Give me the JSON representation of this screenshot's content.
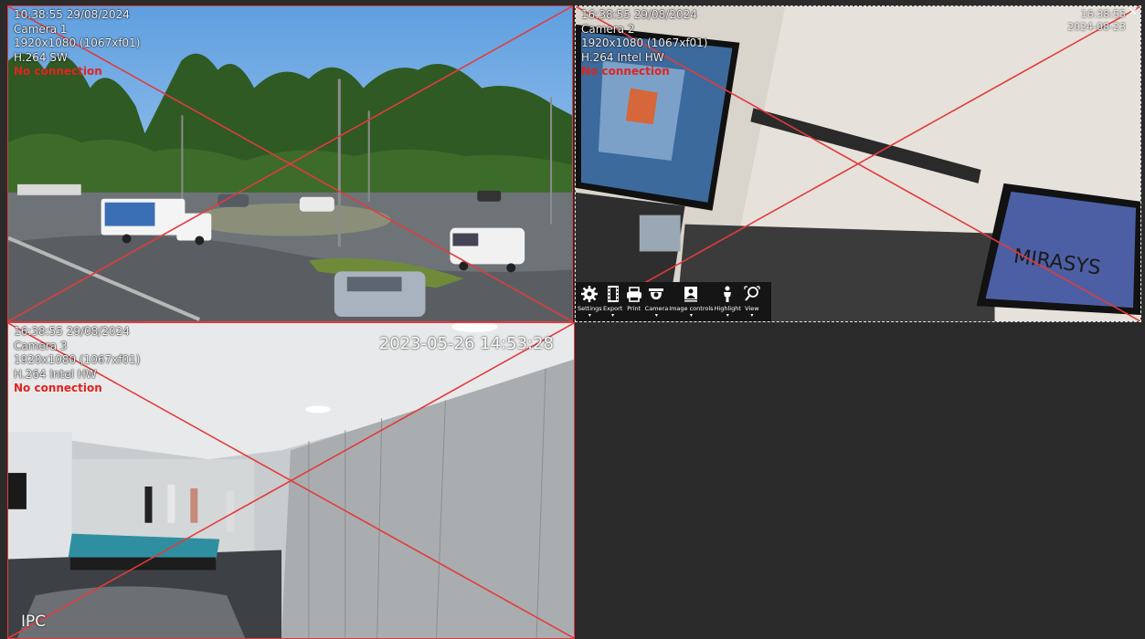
{
  "tiles": [
    {
      "timestamp": "10:38:55  29/08/2024",
      "camera_name": "Camera 1",
      "resolution": "1920x1080 (1067xf01)",
      "codec": "H.264 SW",
      "status": "No connection"
    },
    {
      "timestamp": "16:38:55  29/08/2024",
      "camera_name": "Camera 2",
      "resolution": "1920x1080 (1067xf01)",
      "codec": "H.264 Intel HW",
      "status": "No connection",
      "corner_time": "16:38:55",
      "corner_date": "2024-08-23",
      "close_glyph": "✕",
      "brand_text": "MIRASYS"
    },
    {
      "timestamp": "16:38:55  29/08/2024",
      "camera_name": "Camera 3",
      "resolution": "1920x1080 (1067xf01)",
      "codec": "H.264 Intel HW",
      "status": "No connection",
      "video_timestamp": "2023-05-26 14:53:28",
      "video_label": "IPC"
    }
  ],
  "toolbar": {
    "items": [
      {
        "label": "Settings",
        "icon": "gear-icon",
        "dropdown": "▾"
      },
      {
        "label": "Export",
        "icon": "film-export-icon",
        "dropdown": "▾"
      },
      {
        "label": "Print",
        "icon": "printer-icon",
        "dropdown": ""
      },
      {
        "label": "Camera",
        "icon": "dome-camera-icon",
        "dropdown": "▾"
      },
      {
        "label": "Image controls",
        "icon": "image-controls-icon",
        "dropdown": "▾"
      },
      {
        "label": "Highlight",
        "icon": "person-highlight-icon",
        "dropdown": "▾"
      },
      {
        "label": "View",
        "icon": "zoom-view-icon",
        "dropdown": "▾"
      }
    ]
  },
  "colors": {
    "error_red": "#e23b3b",
    "toolbar_bg": "#151515",
    "empty_cell": "#2a2a2a"
  }
}
